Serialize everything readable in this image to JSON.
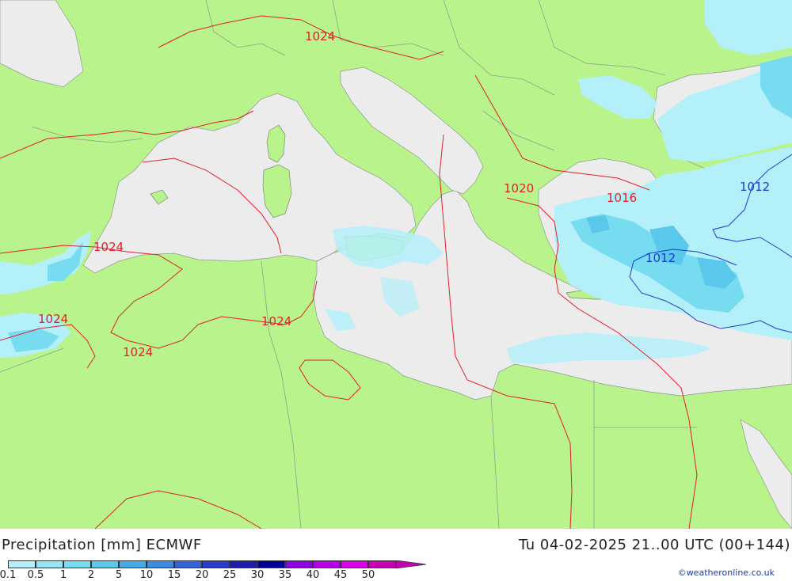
{
  "title": "Precipitation [mm] ECMWF",
  "datetime": "Tu 04-02-2025 21..00 UTC (00+144)",
  "credit": "©weatheronline.co.uk",
  "legend": {
    "labels": [
      "0.1",
      "0.5",
      "1",
      "2",
      "5",
      "10",
      "15",
      "20",
      "25",
      "30",
      "35",
      "40",
      "45",
      "50"
    ],
    "colors": [
      "#b4f0fa",
      "#96e6f5",
      "#78dcf0",
      "#5ac8eb",
      "#46aae6",
      "#3c8ce1",
      "#3264dc",
      "#283cc8",
      "#1e1eaa",
      "#000096",
      "#8c00e6",
      "#b400e6",
      "#dc00e6",
      "#c800b4"
    ]
  },
  "isobars": {
    "labels": [
      "1024",
      "1024",
      "1024",
      "1024",
      "1024",
      "1020",
      "1016",
      "1012",
      "1012"
    ]
  },
  "colors": {
    "land": "#b8f38c",
    "sea": "#ececec",
    "isobar_high": "#e0202a",
    "isobar_low": "#1a3ccc"
  }
}
